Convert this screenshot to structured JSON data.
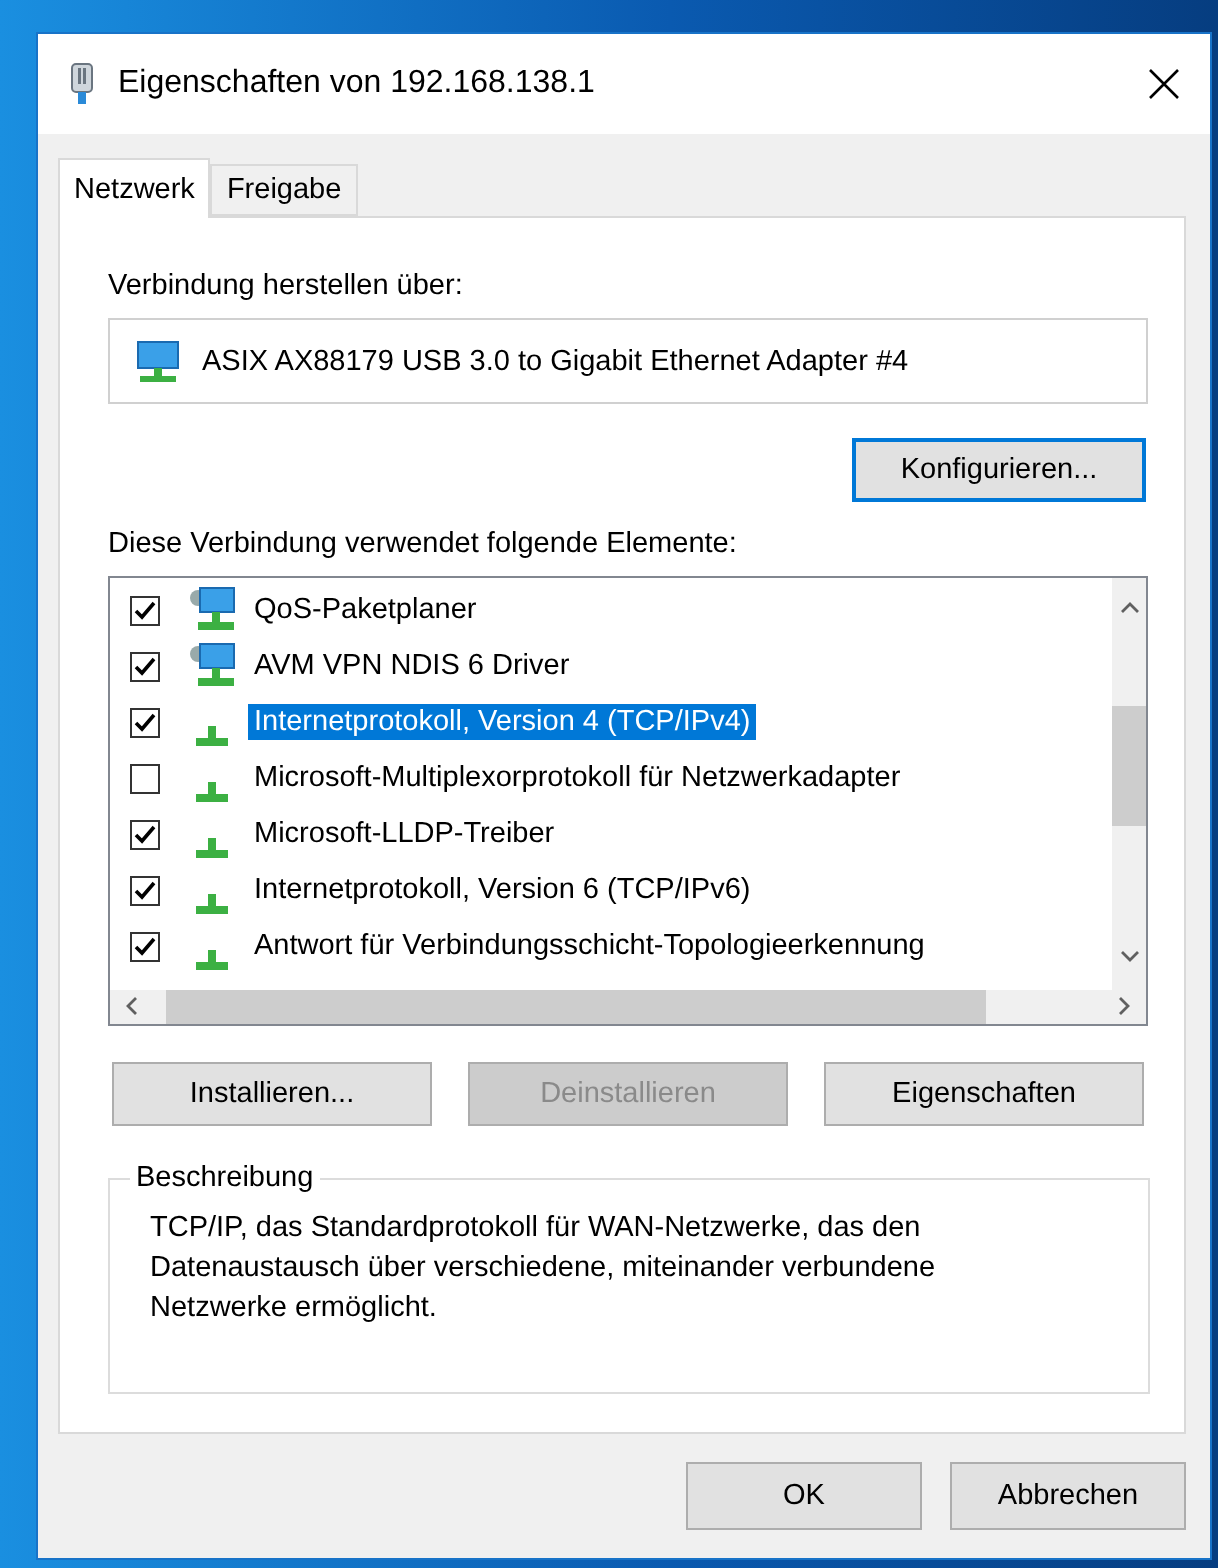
{
  "window": {
    "title": "Eigenschaften von 192.168.138.1"
  },
  "tabs": [
    {
      "label": "Netzwerk",
      "selected": true
    },
    {
      "label": "Freigabe",
      "selected": false
    }
  ],
  "connect_label": "Verbindung herstellen über:",
  "adapter": {
    "name": "ASIX AX88179 USB 3.0 to Gigabit Ethernet Adapter #4"
  },
  "configure_button": "Konfigurieren...",
  "elements_label": "Diese Verbindung verwendet folgende Elemente:",
  "elements": [
    {
      "label": "QoS-Paketplaner",
      "kind": "service",
      "checked": true,
      "selected": false
    },
    {
      "label": "AVM VPN NDIS 6 Driver",
      "kind": "service",
      "checked": true,
      "selected": false
    },
    {
      "label": "Internetprotokoll, Version 4 (TCP/IPv4)",
      "kind": "protocol",
      "checked": true,
      "selected": true
    },
    {
      "label": "Microsoft-Multiplexorprotokoll für Netzwerkadapter",
      "kind": "protocol",
      "checked": false,
      "selected": false
    },
    {
      "label": "Microsoft-LLDP-Treiber",
      "kind": "protocol",
      "checked": true,
      "selected": false
    },
    {
      "label": "Internetprotokoll, Version 6 (TCP/IPv6)",
      "kind": "protocol",
      "checked": true,
      "selected": false
    },
    {
      "label": "Antwort für Verbindungsschicht-Topologieerkennung",
      "kind": "protocol",
      "checked": true,
      "selected": false
    }
  ],
  "buttons": [
    {
      "label": "Installieren...",
      "disabled": false
    },
    {
      "label": "Deinstallieren",
      "disabled": true
    },
    {
      "label": "Eigenschaften",
      "disabled": false
    }
  ],
  "description": {
    "legend": "Beschreibung",
    "text": "TCP/IP, das Standardprotokoll für WAN-Netzwerke, das den Datenaustausch über verschiedene, miteinander verbundene Netzwerke ermöglicht."
  },
  "dialog_buttons": [
    {
      "label": "OK"
    },
    {
      "label": "Abbrechen"
    }
  ]
}
